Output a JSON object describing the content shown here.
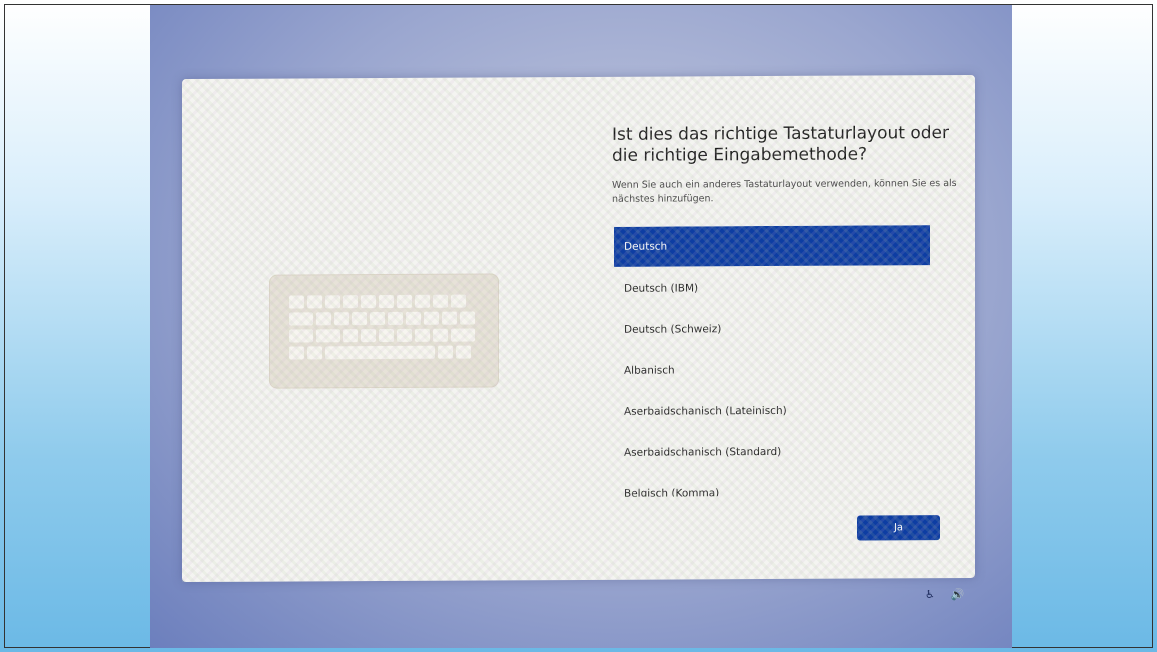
{
  "dialog": {
    "title": "Ist dies das richtige Tastaturlayout oder die richtige Eingabemethode?",
    "subtitle": "Wenn Sie auch ein anderes Tastaturlayout verwenden, können Sie es als nächstes hinzufügen.",
    "layouts": [
      {
        "label": "Deutsch",
        "selected": true
      },
      {
        "label": "Deutsch (IBM)",
        "selected": false
      },
      {
        "label": "Deutsch (Schweiz)",
        "selected": false
      },
      {
        "label": "Albanisch",
        "selected": false
      },
      {
        "label": "Aserbaidschanisch (Lateinisch)",
        "selected": false
      },
      {
        "label": "Aserbaidschanisch (Standard)",
        "selected": false
      },
      {
        "label": "Belgisch (Komma)",
        "selected": false
      }
    ],
    "confirm_label": "Ja"
  },
  "taskbar": {
    "accessibility_icon": "♿",
    "volume_icon": "🔊"
  },
  "colors": {
    "accent": "#0d3da3"
  }
}
